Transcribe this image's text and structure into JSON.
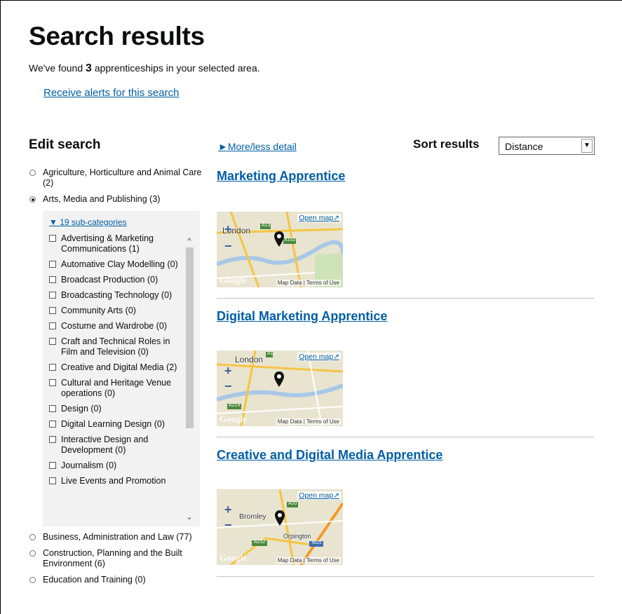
{
  "header": {
    "title": "Search results",
    "found_prefix": "We've found",
    "found_count": "3",
    "found_suffix": "apprenticeships in your selected area.",
    "alerts_link": "Receive alerts for this search"
  },
  "sidebar": {
    "title": "Edit search",
    "categories_top": [
      {
        "label": "Agriculture, Horticulture and Animal Care (2)",
        "selected": false
      },
      {
        "label": "Arts, Media and Publishing (3)",
        "selected": true
      }
    ],
    "subcategories_toggle": "19 sub-categories",
    "subcategories": [
      "Advertising & Marketing Communications (1)",
      "Automative Clay Modelling (0)",
      "Broadcast Production (0)",
      "Broadcasting Technology (0)",
      "Community Arts (0)",
      "Costume and Wardrobe (0)",
      "Craft and Technical Roles in Film and Television (0)",
      "Creative and Digital Media (2)",
      "Cultural and Heritage Venue operations (0)",
      "Design (0)",
      "Digital Learning Design (0)",
      "Interactive Design and Development (0)",
      "Journalism (0)",
      "Live Events and Promotion"
    ],
    "categories_bottom": [
      {
        "label": "Business, Administration and Law (77)",
        "selected": false
      },
      {
        "label": "Construction, Planning and the Built Environment (6)",
        "selected": false
      },
      {
        "label": "Education and Training (0)",
        "selected": false
      }
    ]
  },
  "results_toolbar": {
    "more_less": "More/less detail",
    "sort_label": "Sort results",
    "sort_selected": "Distance"
  },
  "results": [
    {
      "title": "Marketing Apprentice",
      "map_place": "London",
      "road_a": "A13",
      "road_b": "A102"
    },
    {
      "title": "Digital Marketing Apprentice",
      "map_place": "London",
      "road_a": "A1",
      "road_b": "A214"
    },
    {
      "title": "Creative and Digital Media Apprentice",
      "map_place": "Bromley",
      "map_place2": "Orpington",
      "road_a": "A20",
      "road_b": "A232",
      "road_c": "M25"
    }
  ],
  "map_common": {
    "open_map": "Open map",
    "map_data": "Map Data",
    "terms": "Terms of Use",
    "google": "Google"
  },
  "icons": {
    "zoom_in": "+",
    "zoom_out": "−",
    "triangle_right": "►",
    "triangle_down": "▼",
    "chevron_down": "⌄",
    "external": "↗"
  }
}
